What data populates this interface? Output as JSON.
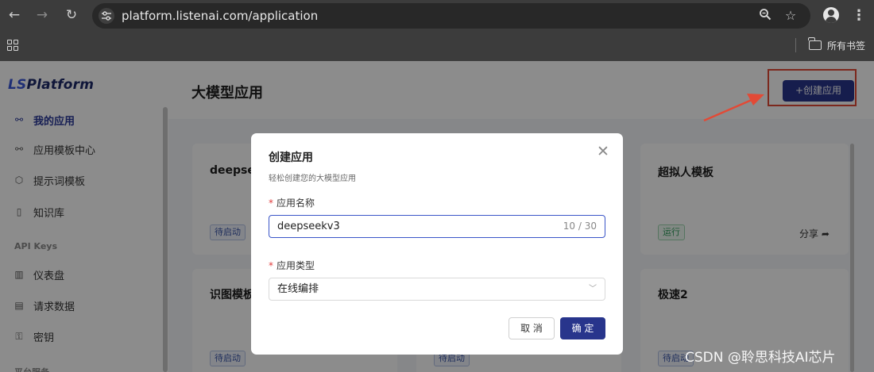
{
  "browser": {
    "url": "platform.listenai.com/application",
    "bookmarks_all": "所有书签"
  },
  "sidebar": {
    "logo_prefix": "LS",
    "logo_suffix": "Platform",
    "items": [
      {
        "label": "我的应用",
        "icon": "apps-icon",
        "active": true
      },
      {
        "label": "应用模板中心",
        "icon": "template-icon",
        "active": false
      },
      {
        "label": "提示词模板",
        "icon": "cube-icon",
        "active": false
      },
      {
        "label": "知识库",
        "icon": "book-icon",
        "active": false
      }
    ],
    "section_api": "API Keys",
    "api_items": [
      {
        "label": "仪表盘",
        "icon": "bar-chart-icon"
      },
      {
        "label": "请求数据",
        "icon": "document-icon"
      },
      {
        "label": "密钥",
        "icon": "key-icon"
      }
    ],
    "section_platform": "平台服务"
  },
  "header": {
    "title": "大模型应用",
    "create_button": "+创建应用"
  },
  "cards": [
    {
      "title": "deepseek",
      "status": "待启动"
    },
    {
      "title": "超拟人模板",
      "status": "运行",
      "share": "分享"
    },
    {
      "title": "识图模板",
      "status": "待启动"
    },
    {
      "title": "极速2",
      "status": "待启动"
    },
    {
      "status": "待启动"
    }
  ],
  "modal": {
    "title": "创建应用",
    "subtitle": "轻松创建您的大模型应用",
    "name_label": "应用名称",
    "name_value": "deepseekv3",
    "name_count": "10 / 30",
    "type_label": "应用类型",
    "type_value": "在线编排",
    "cancel": "取 消",
    "confirm": "确 定"
  },
  "watermark": "CSDN @聆思科技AI芯片",
  "colors": {
    "primary": "#28358c",
    "highlight": "#e24a36",
    "required": "#e03a3a"
  }
}
